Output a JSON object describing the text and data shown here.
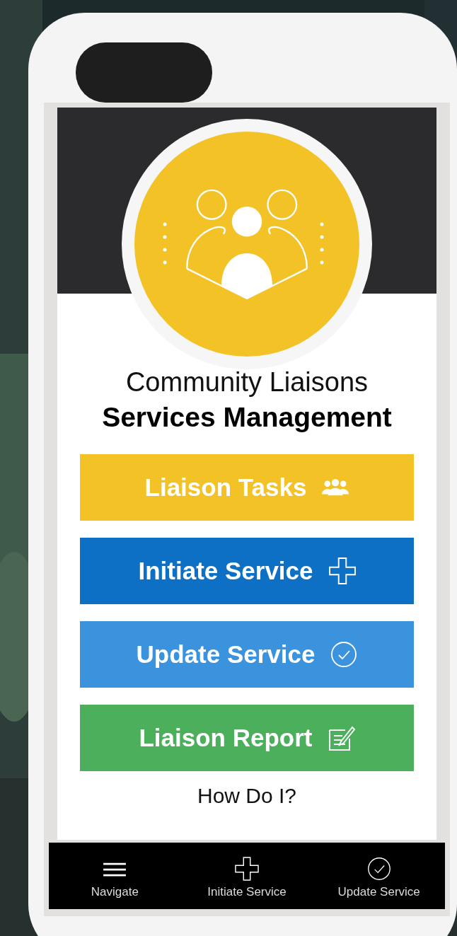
{
  "header": {
    "title": "Community Liaisons",
    "subtitle": "Services Management"
  },
  "buttons": [
    {
      "label": "Liaison Tasks",
      "kind": "people",
      "color": "#f2c226"
    },
    {
      "label": "Initiate Service",
      "kind": "plus",
      "color": "#0d70c5"
    },
    {
      "label": "Update Service",
      "kind": "check",
      "color": "#3a93dc"
    },
    {
      "label": "Liaison Report",
      "kind": "note",
      "color": "#4caf5b"
    }
  ],
  "help_link": "How Do I?",
  "nav": [
    {
      "label": "Navigate",
      "kind": "menu"
    },
    {
      "label": "Initiate Service",
      "kind": "plus"
    },
    {
      "label": "Update Service",
      "kind": "check"
    }
  ]
}
